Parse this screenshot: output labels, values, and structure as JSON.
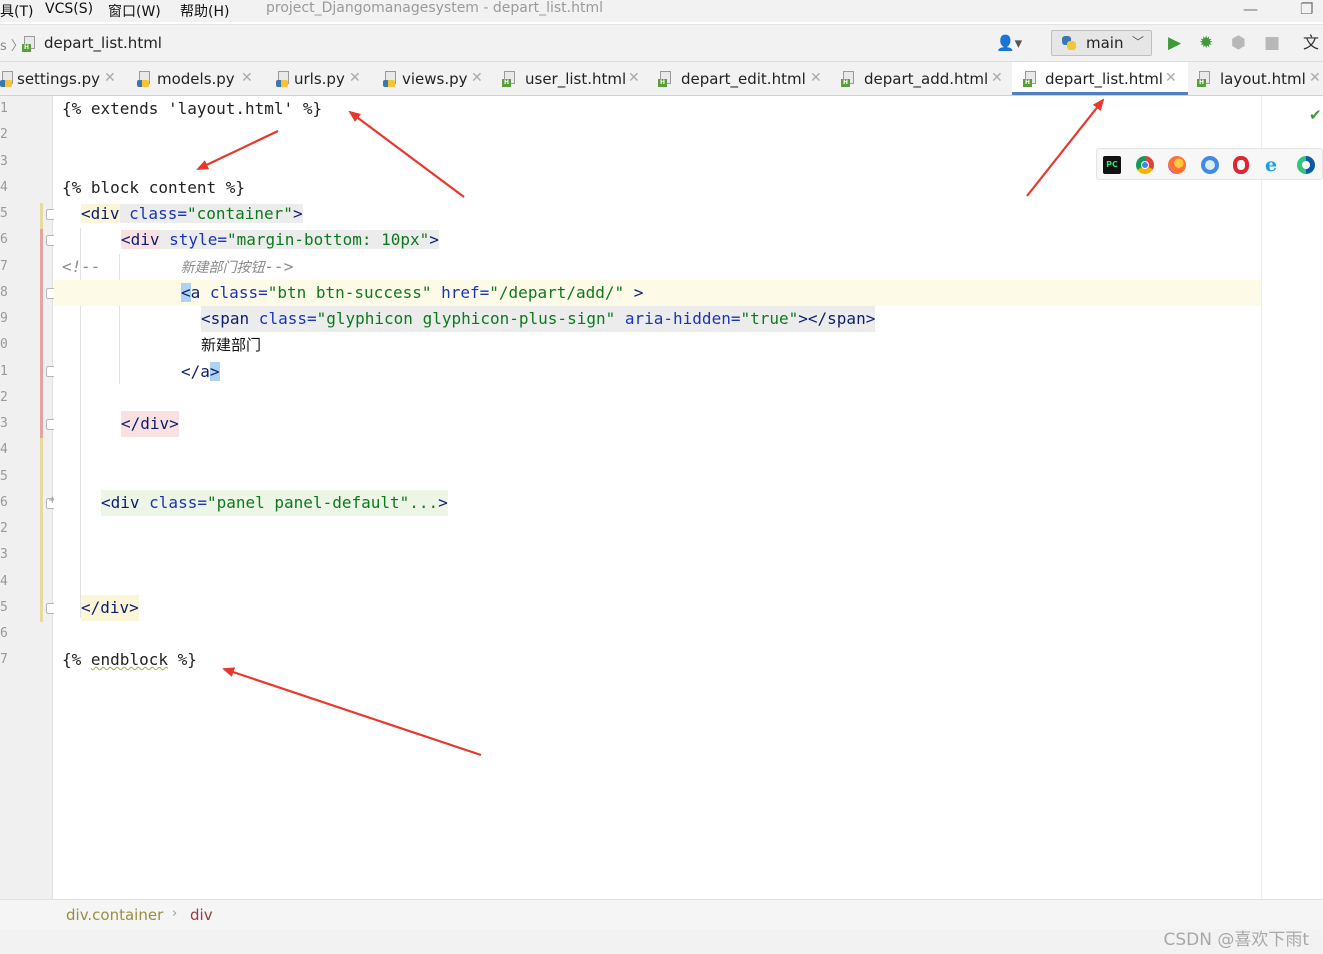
{
  "menu": {
    "items": [
      "具(T)",
      "VCS(S)",
      "窗口(W)",
      "帮助(H)"
    ],
    "window_title": "project_Djangomanagesystem - depart_list.html"
  },
  "breadcrumb": {
    "prefix": "s",
    "file": "depart_list.html"
  },
  "run_config": {
    "label": "main"
  },
  "tabs": [
    {
      "label": "settings.py",
      "kind": "py"
    },
    {
      "label": "models.py",
      "kind": "py"
    },
    {
      "label": "urls.py",
      "kind": "py"
    },
    {
      "label": "views.py",
      "kind": "py"
    },
    {
      "label": "user_list.html",
      "kind": "html"
    },
    {
      "label": "depart_edit.html",
      "kind": "html"
    },
    {
      "label": "depart_add.html",
      "kind": "html"
    },
    {
      "label": "depart_list.html",
      "kind": "html",
      "active": true
    },
    {
      "label": "layout.html",
      "kind": "html"
    }
  ],
  "line_numbers": [
    "1",
    "2",
    "3",
    "4",
    "5",
    "6",
    "7",
    "8",
    "9",
    "0",
    "1",
    "2",
    "3",
    "4",
    "5",
    "6",
    "2",
    "3",
    "4",
    "5",
    "6",
    "7"
  ],
  "code": {
    "l1": "{% extends 'layout.html' %}",
    "l4": "{% block content %}",
    "l5_open": "<div",
    "l5_attr": " class=",
    "l5_val": "\"container\"",
    "l5_close": ">",
    "l6_open": "<div",
    "l6_attr": " style=",
    "l6_val": "\"margin-bottom: 10px\"",
    "l6_close": ">",
    "l7_cmt_open": "<!--",
    "l7_cmt_text": "新建部门按钮",
    "l7_cmt_close": "-->",
    "l8_lt": "<",
    "l8_tag": "a",
    "l8_attr1": " class=",
    "l8_val1": "\"btn btn-success\"",
    "l8_attr2": " href=",
    "l8_val2": "\"/depart/add/\"",
    "l8_close": " >",
    "l9_open": "<span",
    "l9_attr1": " class=",
    "l9_val1": "\"glyphicon glyphicon-plus-sign\"",
    "l9_attr2": " aria-hidden=",
    "l9_val2": "\"true\"",
    "l9_close": "></span>",
    "l10_text": "新建部门",
    "l11_open": "</a",
    "l11_close": ">",
    "l13": "</div>",
    "l16_open": "<div",
    "l16_attr": " class=",
    "l16_val": "\"panel panel-default\"",
    "l16_fold": "...",
    "l16_close": ">",
    "l25": "</div>",
    "l27_open": "{% ",
    "l27_kw": "endblock",
    "l27_close": " %}"
  },
  "status": {
    "crumb1": "div.container",
    "crumb2": "div"
  },
  "watermark": "CSDN @喜欢下雨t",
  "colors": {
    "arrow": "#e8382d",
    "tab_active_underline": "#4f7fbf",
    "current_line": "#fdfbe8"
  }
}
